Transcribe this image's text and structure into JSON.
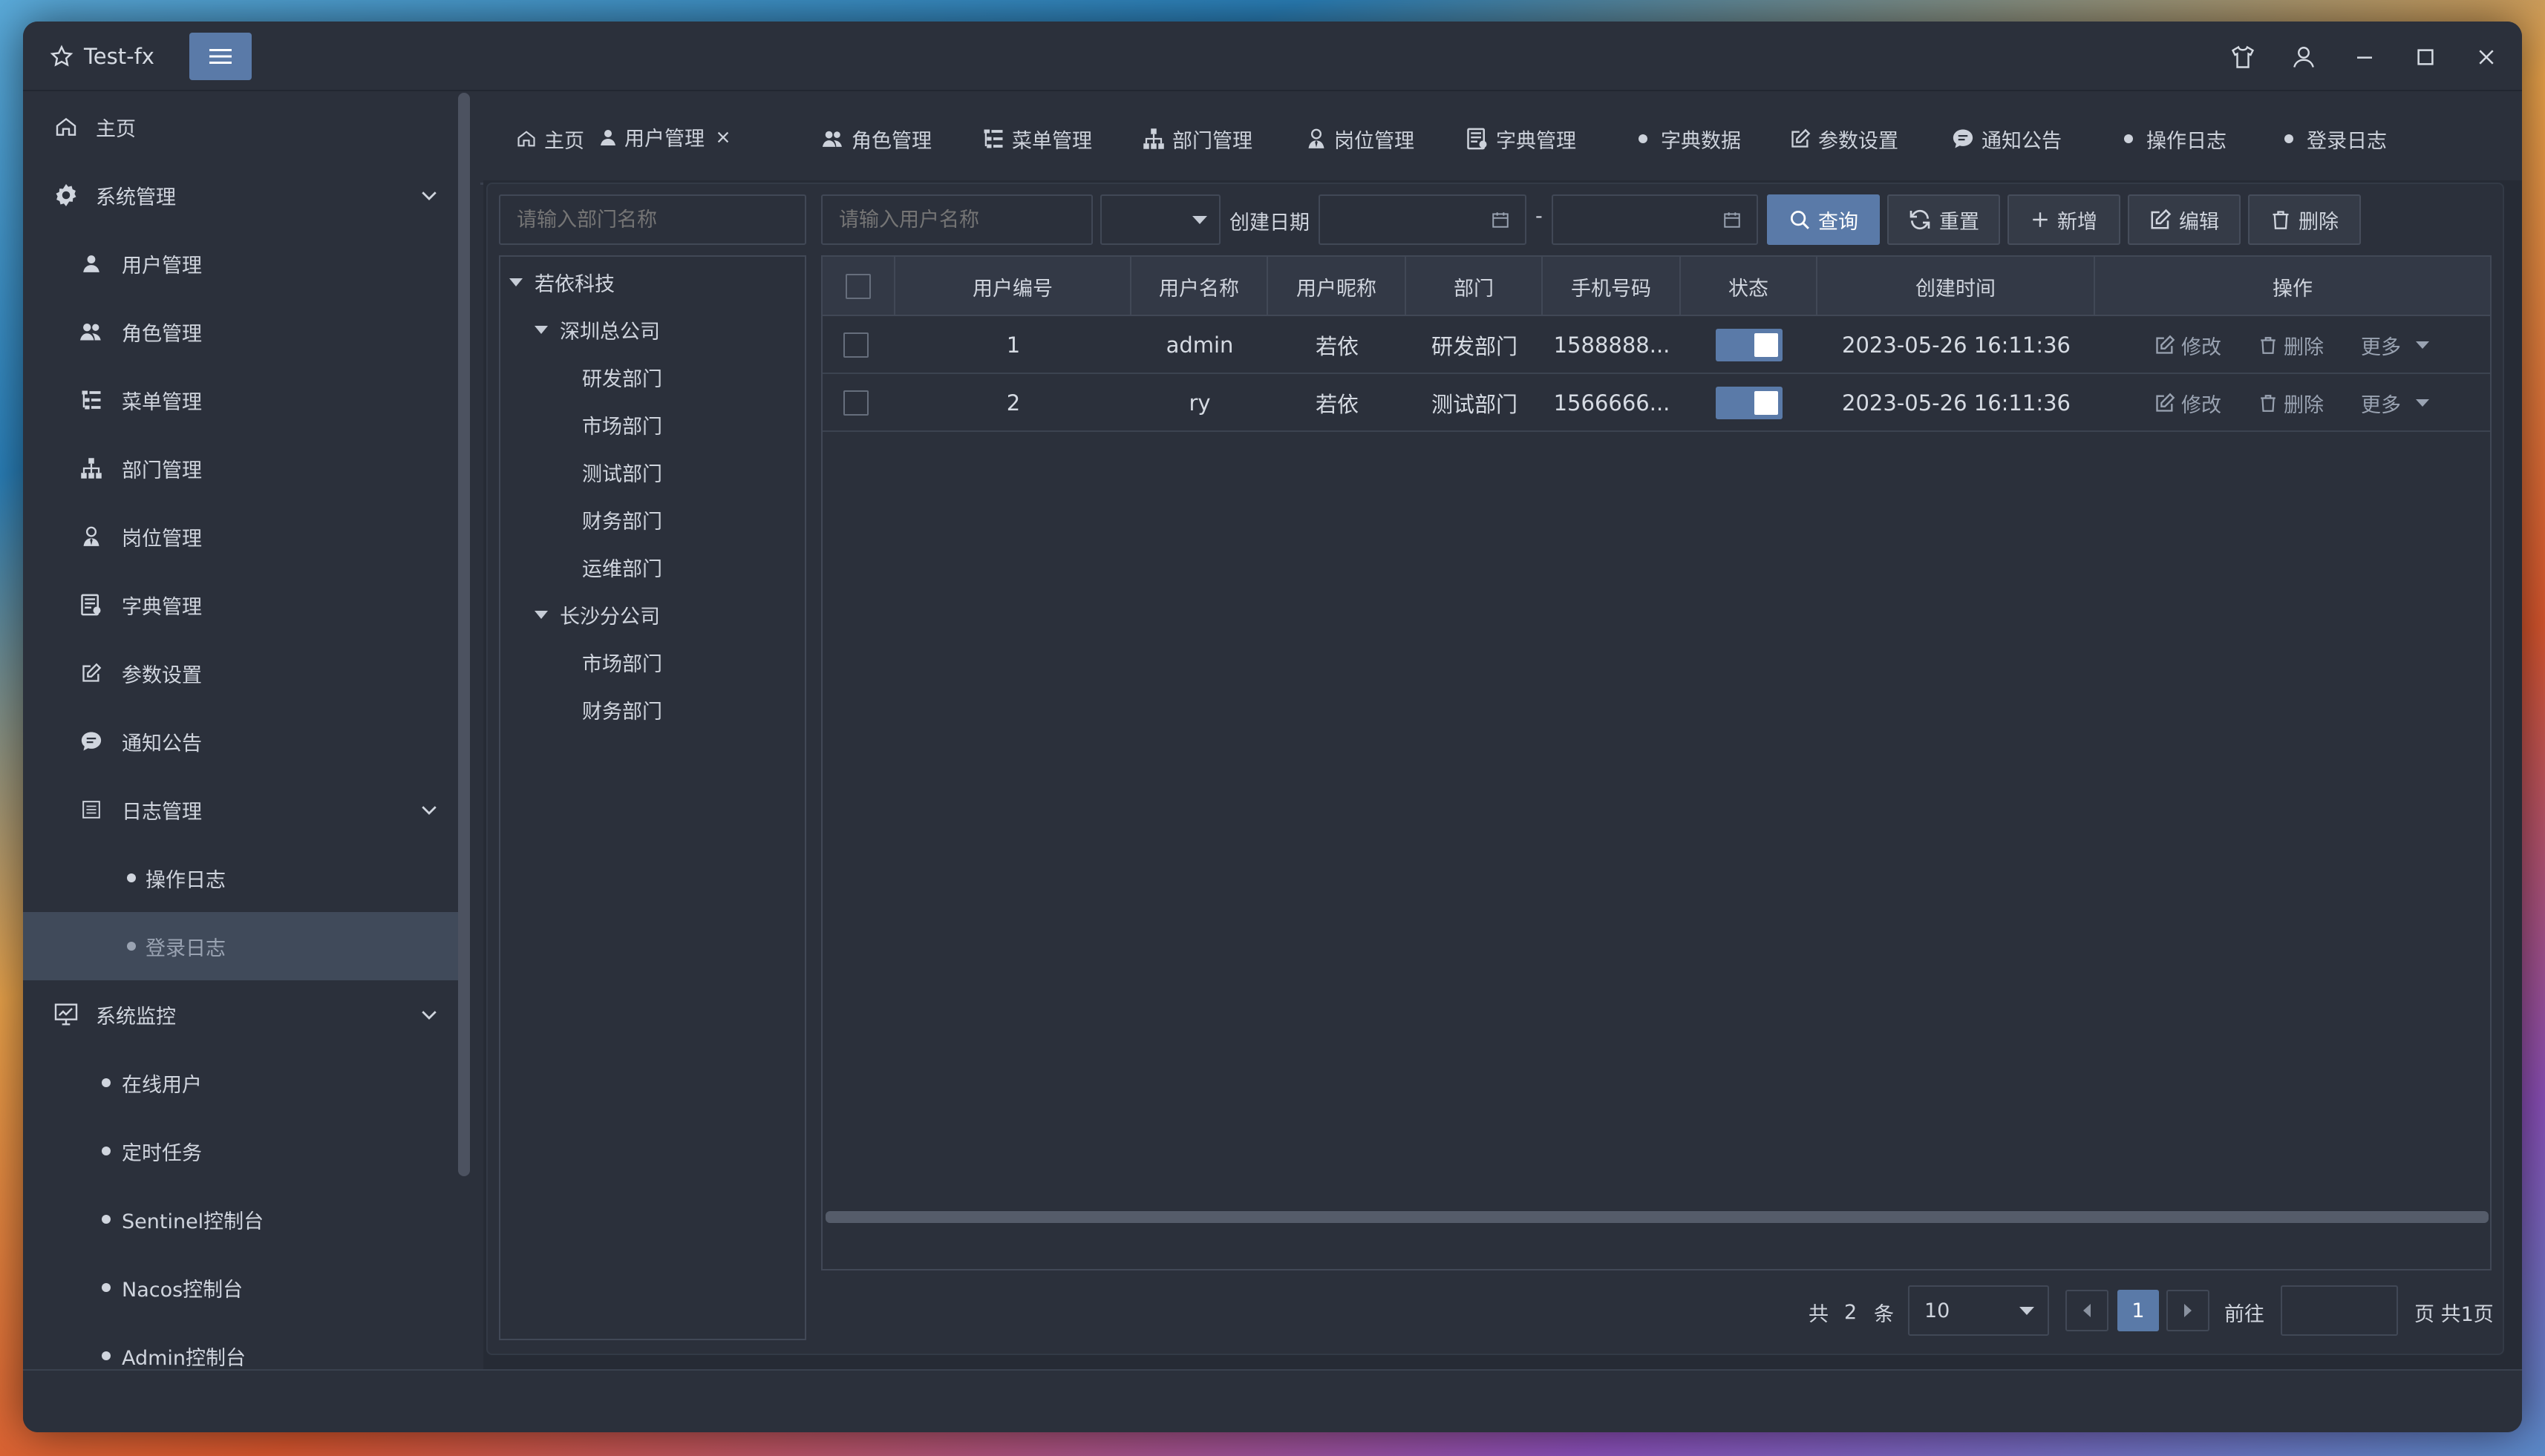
{
  "app": {
    "title": "Test-fx"
  },
  "sidebar": {
    "items": [
      {
        "label": "主页"
      },
      {
        "label": "系统管理"
      },
      {
        "label": "用户管理"
      },
      {
        "label": "角色管理"
      },
      {
        "label": "菜单管理"
      },
      {
        "label": "部门管理"
      },
      {
        "label": "岗位管理"
      },
      {
        "label": "字典管理"
      },
      {
        "label": "参数设置"
      },
      {
        "label": "通知公告"
      },
      {
        "label": "日志管理"
      },
      {
        "label": "操作日志"
      },
      {
        "label": "登录日志"
      },
      {
        "label": "系统监控"
      },
      {
        "label": "在线用户"
      },
      {
        "label": "定时任务"
      },
      {
        "label": "Sentinel控制台"
      },
      {
        "label": "Nacos控制台"
      },
      {
        "label": "Admin控制台"
      }
    ]
  },
  "tabs": [
    "主页",
    "用户管理",
    "角色管理",
    "菜单管理",
    "部门管理",
    "岗位管理",
    "字典管理",
    "字典数据",
    "参数设置",
    "通知公告",
    "操作日志",
    "登录日志"
  ],
  "search": {
    "dept_placeholder": "请输入部门名称",
    "user_placeholder": "请输入用户名称",
    "date_label": "创建日期",
    "date_sep": "-"
  },
  "toolbar": {
    "query": "查询",
    "reset": "重置",
    "add": "新增",
    "edit": "编辑",
    "delete": "删除"
  },
  "tree": {
    "root": "若依科技",
    "sz": "深圳总公司",
    "sz_children": [
      "研发部门",
      "市场部门",
      "测试部门",
      "财务部门",
      "运维部门"
    ],
    "cs": "长沙分公司",
    "cs_children": [
      "市场部门",
      "财务部门"
    ]
  },
  "table": {
    "headers": {
      "id": "用户编号",
      "name": "用户名称",
      "nick": "用户昵称",
      "dept": "部门",
      "phone": "手机号码",
      "status": "状态",
      "time": "创建时间",
      "ops": "操作"
    },
    "rows": [
      {
        "id": "1",
        "name": "admin",
        "nick": "若依",
        "dept": "研发部门",
        "phone": "1588888...",
        "time": "2023-05-26 16:11:36"
      },
      {
        "id": "2",
        "name": "ry",
        "nick": "若依",
        "dept": "测试部门",
        "phone": "1566666...",
        "time": "2023-05-26 16:11:36"
      }
    ],
    "op_edit": "修改",
    "op_delete": "删除",
    "op_more": "更多"
  },
  "pagination": {
    "total_prefix": "共",
    "total": "2",
    "total_suffix": "条",
    "page_size": "10",
    "current": "1",
    "goto": "前往",
    "suffix": "页 共1页"
  },
  "colors": {
    "accent": "#5a7aa8",
    "bg": "#2b303b"
  }
}
